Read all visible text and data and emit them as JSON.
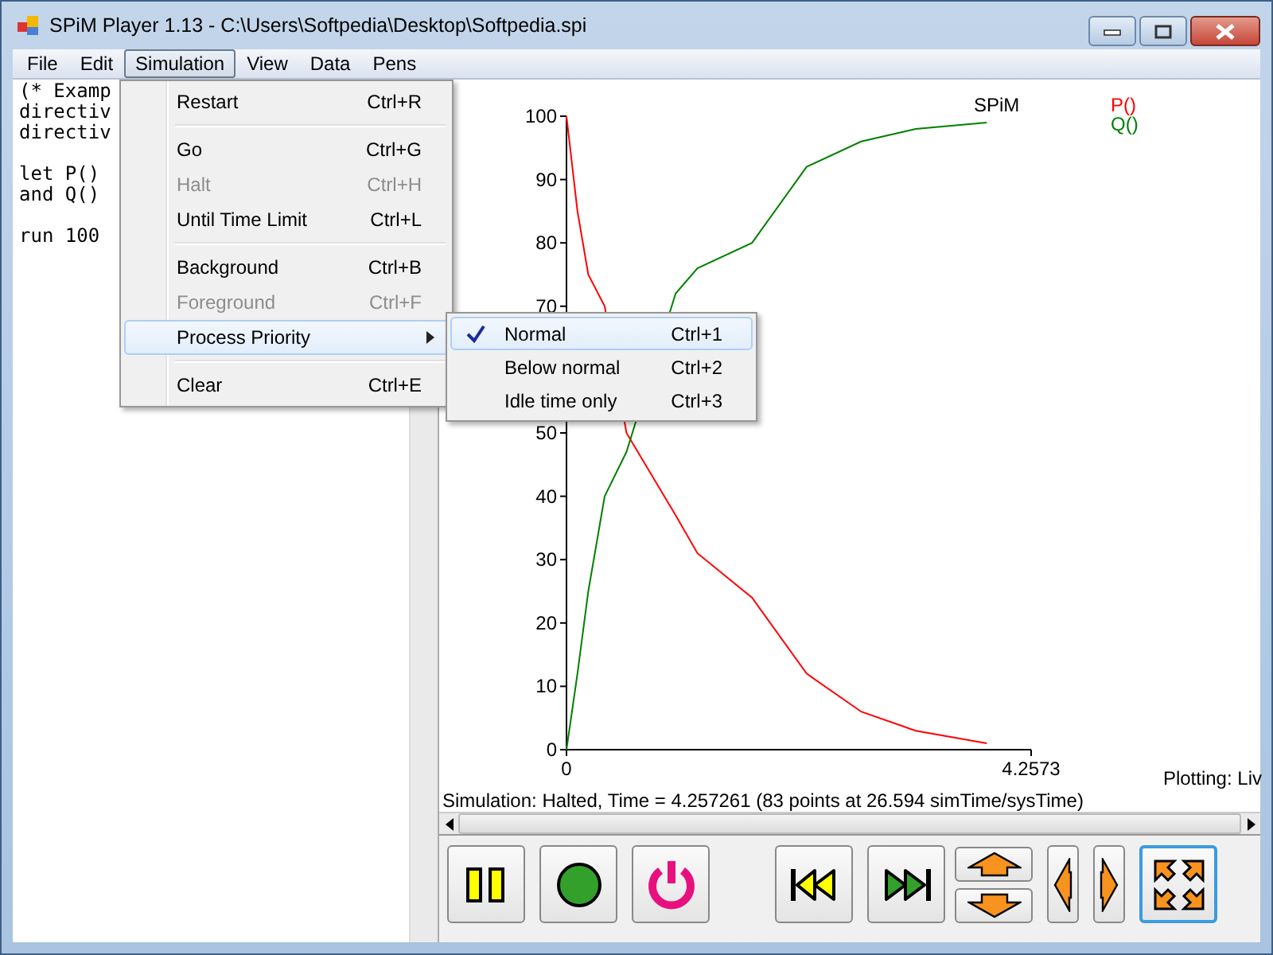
{
  "window": {
    "title": "SPiM Player 1.13 - C:\\Users\\Softpedia\\Desktop\\Softpedia.spi"
  },
  "menu_bar": [
    {
      "label": "File",
      "selected": false
    },
    {
      "label": "Edit",
      "selected": false
    },
    {
      "label": "Simulation",
      "selected": true
    },
    {
      "label": "View",
      "selected": false
    },
    {
      "label": "Data",
      "selected": false
    },
    {
      "label": "Pens",
      "selected": false
    }
  ],
  "editor_text": "(* Examp\ndirectiv\ndirectiv\n\nlet P()\nand Q()\n\nrun 100",
  "simulation_menu": {
    "items": [
      {
        "kind": "item",
        "label": "Restart",
        "shortcut": "Ctrl+R",
        "disabled": false,
        "selected": false
      },
      {
        "kind": "separator"
      },
      {
        "kind": "item",
        "label": "Go",
        "shortcut": "Ctrl+G",
        "disabled": false,
        "selected": false
      },
      {
        "kind": "item",
        "label": "Halt",
        "shortcut": "Ctrl+H",
        "disabled": true,
        "selected": false
      },
      {
        "kind": "item",
        "label": "Until Time Limit",
        "shortcut": "Ctrl+L",
        "disabled": false,
        "selected": false
      },
      {
        "kind": "separator"
      },
      {
        "kind": "item",
        "label": "Background",
        "shortcut": "Ctrl+B",
        "disabled": false,
        "selected": false
      },
      {
        "kind": "item",
        "label": "Foreground",
        "shortcut": "Ctrl+F",
        "disabled": true,
        "selected": false
      },
      {
        "kind": "submenu",
        "label": "Process Priority",
        "disabled": false,
        "selected": true
      },
      {
        "kind": "separator"
      },
      {
        "kind": "item",
        "label": "Clear",
        "shortcut": "Ctrl+E",
        "disabled": false,
        "selected": false
      }
    ]
  },
  "priority_submenu": {
    "items": [
      {
        "label": "Normal",
        "shortcut": "Ctrl+1",
        "checked": true,
        "selected": true
      },
      {
        "label": "Below normal",
        "shortcut": "Ctrl+2",
        "checked": false,
        "selected": false
      },
      {
        "label": "Idle time only",
        "shortcut": "Ctrl+3",
        "checked": false,
        "selected": false
      }
    ]
  },
  "plot": {
    "chart_data": {
      "type": "line",
      "title": "SPiM",
      "x": [
        0,
        0.1,
        0.2,
        0.35,
        0.55,
        1.0,
        1.2,
        1.7,
        2.2,
        2.7,
        3.2,
        3.85
      ],
      "series": [
        {
          "name": "P()",
          "color": "#ff0000",
          "values": [
            100,
            85,
            75,
            70,
            50,
            37,
            31,
            24,
            12,
            6,
            3,
            1
          ]
        },
        {
          "name": "Q()",
          "color": "#008000",
          "values": [
            0,
            12,
            25,
            40,
            47,
            72,
            76,
            80,
            92,
            96,
            98,
            99
          ]
        }
      ],
      "xlim": [
        0,
        4.2573
      ],
      "ylim": [
        0,
        100
      ],
      "xticks": [
        0,
        4.2573
      ],
      "yticks": [
        0,
        10,
        20,
        30,
        40,
        50,
        70,
        80,
        90,
        100
      ]
    },
    "plotting_status": "Plotting: Liv"
  },
  "status_text": "Simulation: Halted, Time = 4.257261 (83 points at 26.594 simTime/sysTime)",
  "toolbar": [
    {
      "kind": "pause"
    },
    {
      "kind": "record"
    },
    {
      "kind": "power"
    },
    {
      "kind": "rewind"
    },
    {
      "kind": "forward"
    },
    {
      "kind": "updown"
    },
    {
      "kind": "left"
    },
    {
      "kind": "right"
    },
    {
      "kind": "expand",
      "selected": true
    }
  ]
}
